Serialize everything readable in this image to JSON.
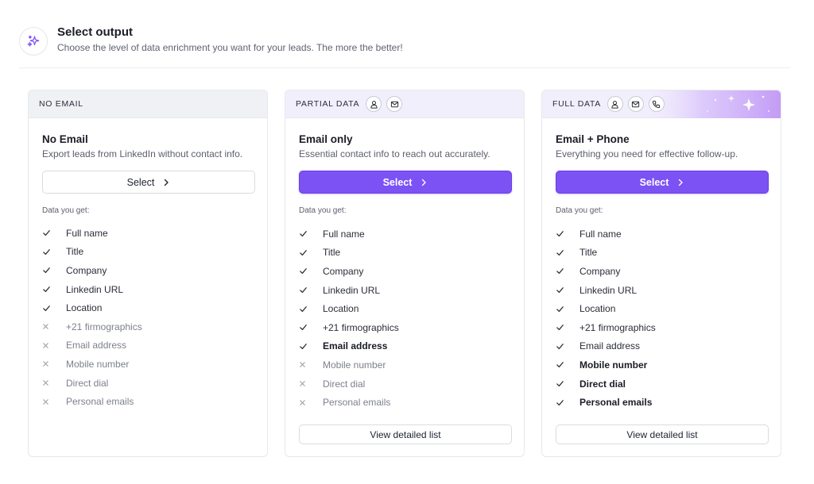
{
  "header": {
    "icon": "sparkles-icon",
    "title": "Select output",
    "subtitle": "Choose the level of data enrichment you want for your leads. The more the better!"
  },
  "colors": {
    "accent": "#7c52f4",
    "head_gray": "#eff1f4",
    "head_lavender": "#f2effd",
    "check": "#2a2d39",
    "cross": "#9a9ea8"
  },
  "cards": [
    {
      "head_label": "NO EMAIL",
      "head_icons": [],
      "title": "No Email",
      "subtitle": "Export leads from LinkedIn without contact info.",
      "select_label": "Select",
      "data_label": "Data you get:",
      "items": [
        {
          "label": "Full name",
          "included": true,
          "bold": false
        },
        {
          "label": "Title",
          "included": true,
          "bold": false
        },
        {
          "label": "Company",
          "included": true,
          "bold": false
        },
        {
          "label": "Linkedin URL",
          "included": true,
          "bold": false
        },
        {
          "label": "Location",
          "included": true,
          "bold": false
        },
        {
          "label": "+21 firmographics",
          "included": false,
          "bold": false
        },
        {
          "label": "Email address",
          "included": false,
          "bold": false
        },
        {
          "label": "Mobile number",
          "included": false,
          "bold": false
        },
        {
          "label": "Direct dial",
          "included": false,
          "bold": false
        },
        {
          "label": "Personal emails",
          "included": false,
          "bold": false
        }
      ]
    },
    {
      "head_label": "PARTIAL DATA",
      "head_icons": [
        "person-icon",
        "mail-icon"
      ],
      "title": "Email only",
      "subtitle": "Essential contact info to reach out accurately.",
      "select_label": "Select",
      "data_label": "Data you get:",
      "items": [
        {
          "label": "Full name",
          "included": true,
          "bold": false
        },
        {
          "label": "Title",
          "included": true,
          "bold": false
        },
        {
          "label": "Company",
          "included": true,
          "bold": false
        },
        {
          "label": "Linkedin URL",
          "included": true,
          "bold": false
        },
        {
          "label": "Location",
          "included": true,
          "bold": false
        },
        {
          "label": "+21 firmographics",
          "included": true,
          "bold": false
        },
        {
          "label": "Email address",
          "included": true,
          "bold": true
        },
        {
          "label": "Mobile number",
          "included": false,
          "bold": false
        },
        {
          "label": "Direct dial",
          "included": false,
          "bold": false
        },
        {
          "label": "Personal emails",
          "included": false,
          "bold": false
        }
      ],
      "view_label": "View detailed list"
    },
    {
      "head_label": "FULL DATA",
      "head_icons": [
        "person-icon",
        "mail-icon",
        "phone-icon"
      ],
      "title": "Email + Phone",
      "subtitle": "Everything you need for effective follow-up.",
      "select_label": "Select",
      "data_label": "Data you get:",
      "items": [
        {
          "label": "Full name",
          "included": true,
          "bold": false
        },
        {
          "label": "Title",
          "included": true,
          "bold": false
        },
        {
          "label": "Company",
          "included": true,
          "bold": false
        },
        {
          "label": "Linkedin URL",
          "included": true,
          "bold": false
        },
        {
          "label": "Location",
          "included": true,
          "bold": false
        },
        {
          "label": "+21 firmographics",
          "included": true,
          "bold": false
        },
        {
          "label": "Email address",
          "included": true,
          "bold": false
        },
        {
          "label": "Mobile number",
          "included": true,
          "bold": true
        },
        {
          "label": "Direct dial",
          "included": true,
          "bold": true
        },
        {
          "label": "Personal emails",
          "included": true,
          "bold": true
        }
      ],
      "view_label": "View detailed list"
    }
  ]
}
